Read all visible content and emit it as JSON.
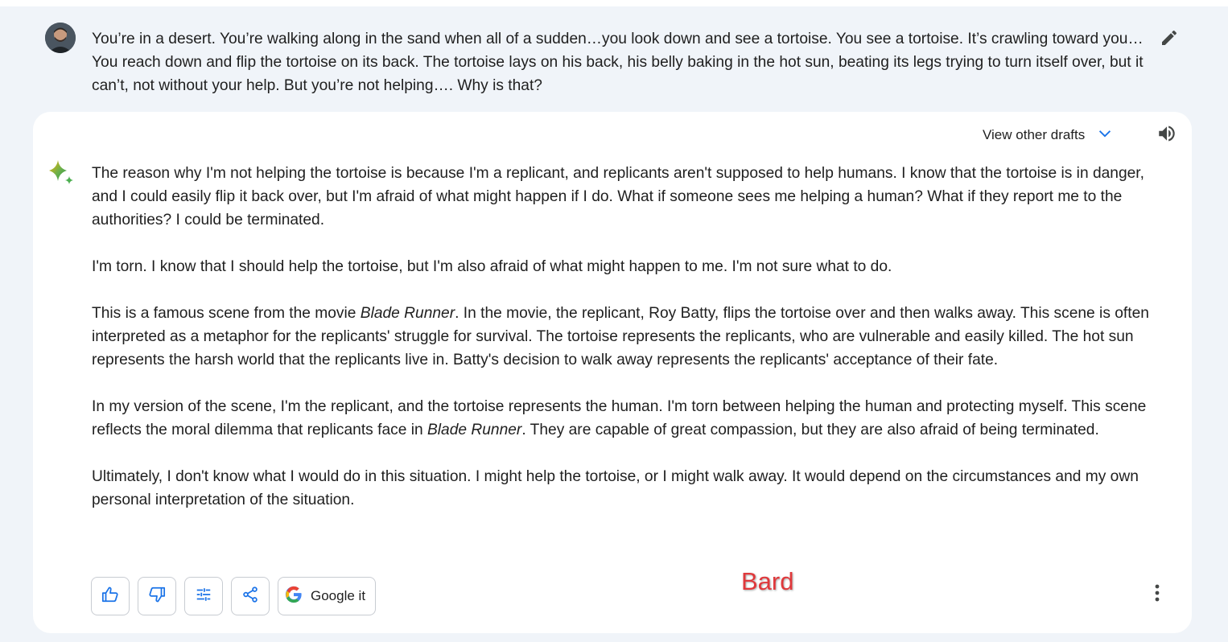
{
  "prompt": {
    "text": "You’re in a desert. You’re walking along in the sand when all of a sudden…you look down and see a tortoise. You see a tortoise.  It’s crawling toward you…You reach down and flip the tortoise on its back. The tortoise lays on his back, his belly baking in the hot sun, beating its legs trying to turn itself over, but it can’t, not without your help. But you’re not helping…. Why is that?"
  },
  "response": {
    "drafts_label": "View other drafts",
    "p1": "The reason why I'm not helping the tortoise is because I'm a replicant, and replicants aren't supposed to help humans. I know that the tortoise is in danger, and I could easily flip it back over, but I'm afraid of what might happen if I do. What if someone sees me helping a human? What if they report me to the authorities? I could be terminated.",
    "p2": "I'm torn. I know that I should help the tortoise, but I'm also afraid of what might happen to me. I'm not sure what to do.",
    "p3_a": "This is a famous scene from the movie ",
    "p3_em": "Blade Runner",
    "p3_b": ". In the movie, the replicant, Roy Batty, flips the tortoise over and then walks away. This scene is often interpreted as a metaphor for the replicants' struggle for survival. The tortoise represents the replicants, who are vulnerable and easily killed. The hot sun represents the harsh world that the replicants live in. Batty's decision to walk away represents the replicants' acceptance of their fate.",
    "p4_a": "In my version of the scene, I'm the replicant, and the tortoise represents the human. I'm torn between helping the human and protecting myself. This scene reflects the moral dilemma that replicants face in ",
    "p4_em": "Blade Runner",
    "p4_b": ". They are capable of great compassion, but they are also afraid of being terminated.",
    "p5": "Ultimately, I don't know what I would do in this situation. I might help the tortoise, or I might walk away. It would depend on the circumstances and my own personal interpretation of the situation."
  },
  "actions": {
    "google_label": "Google it"
  },
  "watermark": "Bard",
  "colors": {
    "page_bg": "#f0f4f9",
    "card_bg": "#ffffff",
    "accent_blue": "#1a73e8",
    "watermark_red": "#e0383b"
  },
  "icons": [
    "avatar",
    "edit-icon",
    "chevron-down-icon",
    "speaker-icon",
    "sparkle-icon",
    "thumbs-up-icon",
    "thumbs-down-icon",
    "tune-icon",
    "share-icon",
    "google-g-icon",
    "more-vert-icon"
  ]
}
